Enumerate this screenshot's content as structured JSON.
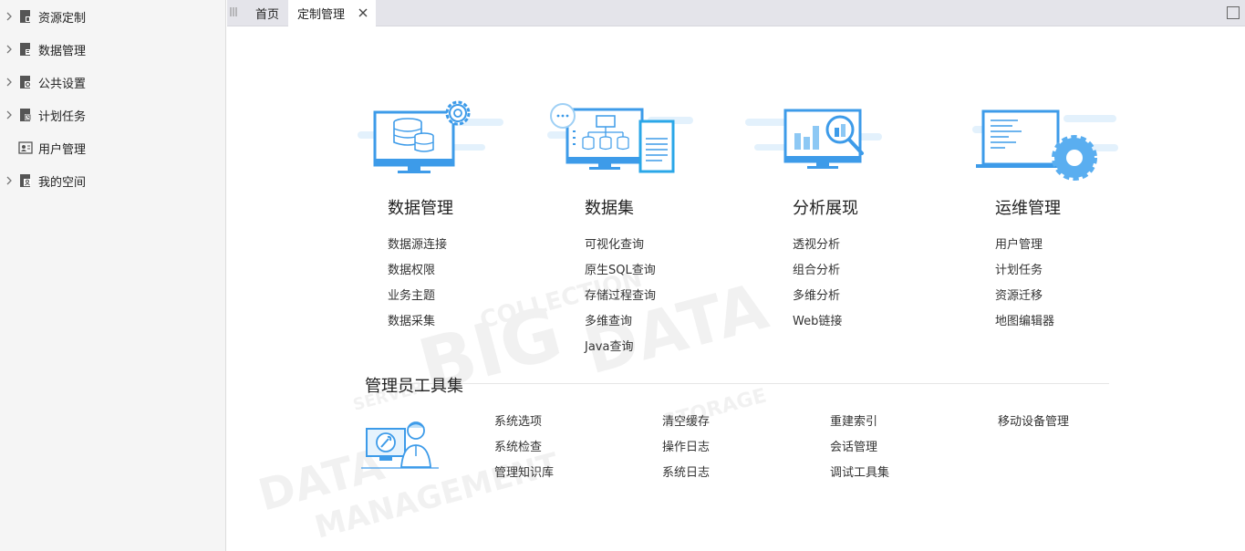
{
  "sidebar": {
    "items": [
      {
        "label": "资源定制",
        "icon": "resource-icon",
        "expandable": true
      },
      {
        "label": "数据管理",
        "icon": "data-icon",
        "expandable": true
      },
      {
        "label": "公共设置",
        "icon": "settings-icon",
        "expandable": true
      },
      {
        "label": "计划任务",
        "icon": "schedule-icon",
        "expandable": true
      },
      {
        "label": "用户管理",
        "icon": "user-admin-icon",
        "expandable": false
      },
      {
        "label": "我的空间",
        "icon": "my-space-icon",
        "expandable": true
      }
    ]
  },
  "tabs": {
    "home": "首页",
    "active": "定制管理"
  },
  "modules": [
    {
      "title": "数据管理",
      "icon": "database-monitor-icon",
      "links": [
        "数据源连接",
        "数据权限",
        "业务主题",
        "数据采集"
      ]
    },
    {
      "title": "数据集",
      "icon": "dataset-monitor-icon",
      "links": [
        "可视化查询",
        "原生SQL查询",
        "存储过程查询",
        "多维查询",
        "Java查询"
      ]
    },
    {
      "title": "分析展现",
      "icon": "analysis-monitor-icon",
      "links": [
        "透视分析",
        "组合分析",
        "多维分析",
        "Web链接"
      ]
    },
    {
      "title": "运维管理",
      "icon": "ops-laptop-gear-icon",
      "links": [
        "用户管理",
        "计划任务",
        "资源迁移",
        "地图编辑器"
      ]
    }
  ],
  "admin": {
    "title": "管理员工具集",
    "columns": [
      [
        "系统选项",
        "系统检查",
        "管理知识库"
      ],
      [
        "清空缓存",
        "操作日志",
        "系统日志"
      ],
      [
        "重建索引",
        "会话管理",
        "调试工具集"
      ],
      [
        "移动设备管理"
      ]
    ]
  },
  "colors": {
    "accent": "#3d9be9",
    "light_accent": "#d6ecfb",
    "sidebar_bg": "#f5f5f5",
    "tabbar_bg": "#e4e4ea"
  }
}
